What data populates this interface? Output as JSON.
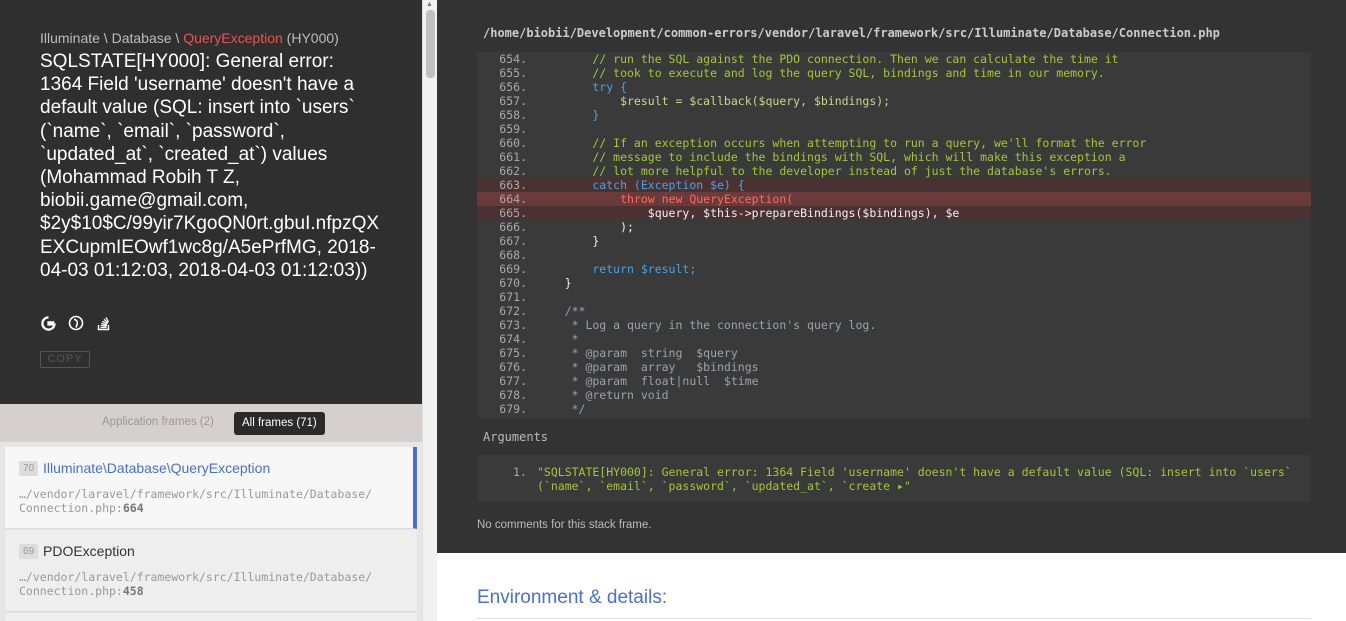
{
  "exception": {
    "namespace_prefix": "Illuminate \\ Database \\ ",
    "class": "QueryException",
    "code": " (HY000)",
    "message": "SQLSTATE[HY000]: General error: 1364 Field 'username' doesn't have a default value (SQL: insert into `users` (`name`, `email`, `password`, `updated_at`, `created_at`) values (Mohammad Robih T Z, biobii.game@gmail.com, $2y$10$C/99yir7KgoQN0rt.gbuI.nfpzQXEXCupmIEOwf1wc8g/A5ePrfMG, 2018-04-03 01:12:03, 2018-04-03 01:12:03))",
    "icons": [
      "google-icon",
      "duckduckgo-icon",
      "stackoverflow-icon"
    ],
    "copy_label": "COPY"
  },
  "frames_filter": {
    "app_frames_label": "Application frames (2)",
    "all_frames_label": "All frames (71)"
  },
  "frames": [
    {
      "index": "70",
      "class": "Illuminate\\Database\\QueryException",
      "file_prefix": "…/vendor/laravel/framework/src/Illuminate/Database/\nConnection.php:",
      "line": "664"
    },
    {
      "index": "69",
      "class": "PDOException",
      "file_prefix": "…/vendor/laravel/framework/src/Illuminate/Database/\nConnection.php:",
      "line": "458"
    }
  ],
  "frame_detail": {
    "file_path": "/home/biobii/Development/common-errors/vendor/laravel/framework/src/Illuminate/Database/Connection.php",
    "arguments_label": "Arguments",
    "argument_number": "1.",
    "argument_value": "\"SQLSTATE[HY000]: General error: 1364 Field 'username' doesn't have a default value (SQL: insert into `users` (`name`, `email`, `password`, `updated_at`, `create ▸\"",
    "no_comments": "No comments for this stack frame."
  },
  "code_lines": [
    {
      "n": "654.",
      "t": "        // run the SQL against the PDO connection. Then we can calculate the time it",
      "k": "cm"
    },
    {
      "n": "655.",
      "t": "        // took to execute and log the query SQL, bindings and time in our memory.",
      "k": "cm"
    },
    {
      "n": "656.",
      "t": "        try {",
      "k": "kw"
    },
    {
      "n": "657.",
      "t": "            $result = $callback($query, $bindings);",
      "k": "var"
    },
    {
      "n": "658.",
      "t": "        }",
      "k": "kw"
    },
    {
      "n": "659.",
      "t": "",
      "k": "pl"
    },
    {
      "n": "660.",
      "t": "        // If an exception occurs when attempting to run a query, we'll format the error",
      "k": "cm"
    },
    {
      "n": "661.",
      "t": "        // message to include the bindings with SQL, which will make this exception a",
      "k": "cm"
    },
    {
      "n": "662.",
      "t": "        // lot more helpful to the developer instead of just the database's errors.",
      "k": "cm"
    },
    {
      "n": "663.",
      "t": "        catch (Exception $e) {",
      "k": "kw"
    },
    {
      "n": "664.",
      "t": "            throw new QueryException(",
      "k": "fn"
    },
    {
      "n": "665.",
      "t": "                $query, $this->prepareBindings($bindings), $e",
      "k": "pl"
    },
    {
      "n": "666.",
      "t": "            );",
      "k": "pl"
    },
    {
      "n": "667.",
      "t": "        }",
      "k": "pl"
    },
    {
      "n": "668.",
      "t": "",
      "k": "pl"
    },
    {
      "n": "669.",
      "t": "        return $result;",
      "k": "kw"
    },
    {
      "n": "670.",
      "t": "    }",
      "k": "pl"
    },
    {
      "n": "671.",
      "t": "",
      "k": "pl"
    },
    {
      "n": "672.",
      "t": "    /**",
      "k": "doc"
    },
    {
      "n": "673.",
      "t": "     * Log a query in the connection's query log.",
      "k": "doc"
    },
    {
      "n": "674.",
      "t": "     *",
      "k": "doc"
    },
    {
      "n": "675.",
      "t": "     * @param  string  $query",
      "k": "doc"
    },
    {
      "n": "676.",
      "t": "     * @param  array   $bindings",
      "k": "doc"
    },
    {
      "n": "677.",
      "t": "     * @param  float|null  $time",
      "k": "doc"
    },
    {
      "n": "678.",
      "t": "     * @return void",
      "k": "doc"
    },
    {
      "n": "679.",
      "t": "     */",
      "k": "doc"
    }
  ],
  "environment": {
    "title": "Environment & details:"
  }
}
